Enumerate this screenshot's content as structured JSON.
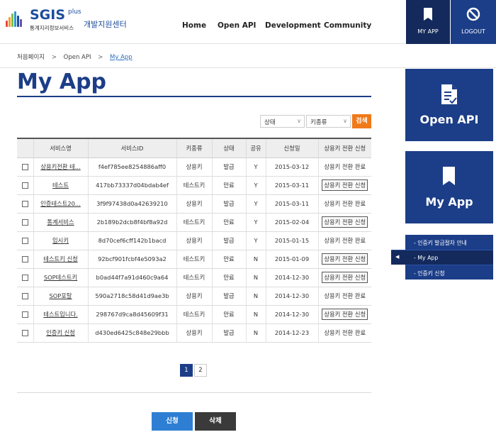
{
  "header": {
    "logo_text": "SGIS",
    "logo_plus": "plus",
    "logo_sub": "통계지리정보서비스",
    "logo_dev": "개발지원센터",
    "nav": [
      "Home",
      "Open API",
      "Development",
      "Community"
    ],
    "myapp_label": "MY APP",
    "logout_label": "LOGOUT"
  },
  "breadcrumb": {
    "items": [
      "처음페이지",
      "Open API",
      "My App"
    ]
  },
  "page": {
    "title": "My App"
  },
  "filters": {
    "status_placeholder": "상태",
    "keytype_placeholder": "키종류",
    "search_label": "검색"
  },
  "table": {
    "columns": [
      "",
      "서비스명",
      "서비스ID",
      "키종류",
      "상태",
      "공유",
      "신청일",
      "상용키 전환 신청"
    ],
    "rows": [
      {
        "name": "상용키전환 테...",
        "id": "f4ef785ee8254886aff0",
        "key_type": "상용키",
        "status": "발급",
        "share": "Y",
        "date": "2015-03-12",
        "convert": "상용키 전환 완료",
        "convert_btn": false
      },
      {
        "name": "테스트",
        "id": "417bb73337d04bdab4ef",
        "key_type": "테스트키",
        "status": "만료",
        "share": "Y",
        "date": "2015-03-11",
        "convert": "상용키 전환 신청",
        "convert_btn": true
      },
      {
        "name": "인증테스트20...",
        "id": "3f9f97438d0a42639210",
        "key_type": "상용키",
        "status": "발급",
        "share": "Y",
        "date": "2015-03-11",
        "convert": "상용키 전환 완료",
        "convert_btn": false
      },
      {
        "name": "통계서비스",
        "id": "2b189b2dcb8f4bf8a92d",
        "key_type": "테스트키",
        "status": "만료",
        "share": "Y",
        "date": "2015-02-04",
        "convert": "상용키 전환 신청",
        "convert_btn": true
      },
      {
        "name": "임시키",
        "id": "8d70cef6cff142b1bacd",
        "key_type": "상용키",
        "status": "발급",
        "share": "Y",
        "date": "2015-01-15",
        "convert": "상용키 전환 완료",
        "convert_btn": false
      },
      {
        "name": "테스트키 신청",
        "id": "92bcf901fcbf4e5093a2",
        "key_type": "테스트키",
        "status": "만료",
        "share": "N",
        "date": "2015-01-09",
        "convert": "상용키 전환 신청",
        "convert_btn": true
      },
      {
        "name": "SOP테스트키",
        "id": "b0ad44f7a91d460c9a64",
        "key_type": "테스트키",
        "status": "만료",
        "share": "N",
        "date": "2014-12-30",
        "convert": "상용키 전환 신청",
        "convert_btn": true
      },
      {
        "name": "SOP포탈",
        "id": "590a2718c58d41d9ae3b",
        "key_type": "상용키",
        "status": "발급",
        "share": "N",
        "date": "2014-12-30",
        "convert": "상용키 전환 완료",
        "convert_btn": false
      },
      {
        "name": "테스트입니다.",
        "id": "298767d9ca8d45609f31",
        "key_type": "테스트키",
        "status": "만료",
        "share": "N",
        "date": "2014-12-30",
        "convert": "상용키 전환 신청",
        "convert_btn": true
      },
      {
        "name": "인증키 신청",
        "id": "d430ed6425c848e29bbb",
        "key_type": "상용키",
        "status": "발급",
        "share": "N",
        "date": "2014-12-23",
        "convert": "상용키 전환 완료",
        "convert_btn": false
      }
    ]
  },
  "pagination": {
    "pages": [
      "1",
      "2"
    ],
    "current": "1"
  },
  "actions": {
    "apply_label": "신청",
    "delete_label": "삭제"
  },
  "sidebar": {
    "card_openapi": "Open API",
    "card_myapp": "My App",
    "menu": [
      "- 인증키 발급절차 안내",
      "- My App",
      "- 인증키 신청"
    ],
    "active_index": 1
  },
  "colors": {
    "brand_navy": "#1c3e88",
    "brand_dark": "#142a5c",
    "search_orange": "#f07a1a",
    "apply_blue": "#2e7fd4"
  }
}
